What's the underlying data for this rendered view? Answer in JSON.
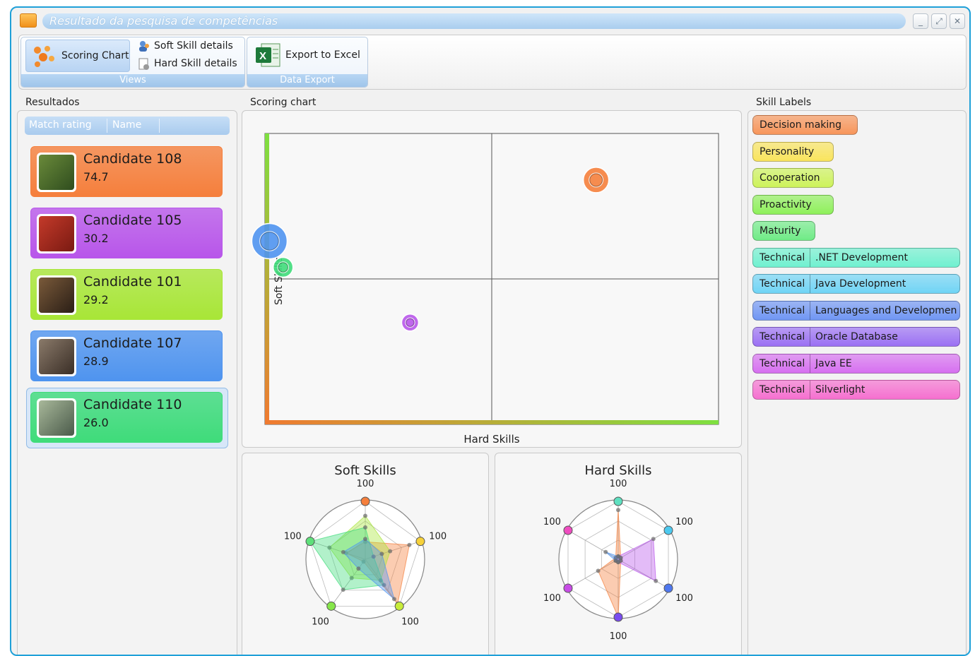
{
  "window": {
    "title": "Resultado da pesquisa de competências",
    "buttons": [
      "_",
      "⤢",
      "✕"
    ]
  },
  "ribbon": {
    "views_group": {
      "label": "Views",
      "scoring_chart": "Scoring Chart",
      "soft_skill_details": "Soft Skill details",
      "hard_skill_details": "Hard Skill details"
    },
    "export_group": {
      "label": "Data Export",
      "export_excel": "Export to Excel"
    }
  },
  "results": {
    "title": "Resultados",
    "columns": [
      "Match rating",
      "Name"
    ],
    "candidates": [
      {
        "name": "Candidate 108",
        "score": "74.7",
        "color": "#f57f3c"
      },
      {
        "name": "Candidate 105",
        "score": "30.2",
        "color": "#b856ea"
      },
      {
        "name": "Candidate 101",
        "score": "29.2",
        "color": "#a8e637"
      },
      {
        "name": "Candidate 107",
        "score": "28.9",
        "color": "#4f94ef"
      },
      {
        "name": "Candidate 110",
        "score": "26.0",
        "color": "#3fdc7a"
      }
    ]
  },
  "scoring": {
    "title": "Scoring chart",
    "xlabel": "Hard Skills",
    "ylabel": "Soft Skills"
  },
  "chart_data": [
    {
      "type": "scatter",
      "title": "Scoring chart",
      "xlabel": "Hard Skills",
      "ylabel": "Soft Skills",
      "xlim": [
        0,
        100
      ],
      "ylim": [
        0,
        100
      ],
      "series": [
        {
          "name": "Candidate 108",
          "x": 73,
          "y": 84,
          "color": "#f57f3c"
        },
        {
          "name": "Candidate 107",
          "x": 1,
          "y": 63,
          "color": "#4f94ef"
        },
        {
          "name": "Candidate 110",
          "x": 4,
          "y": 54,
          "color": "#3fdc7a"
        },
        {
          "name": "Candidate 105",
          "x": 32,
          "y": 35,
          "color": "#b856ea"
        }
      ]
    },
    {
      "type": "radar",
      "title": "Soft Skills",
      "axes_labels": [
        "100",
        "100",
        "100",
        "100",
        "100"
      ],
      "axis_colors": [
        "#f57f3c",
        "#f6d13a",
        "#c8ec3a",
        "#86e64a",
        "#5ee07a"
      ],
      "series": [
        {
          "color": "#f57f3c",
          "values": [
            30,
            80,
            95,
            5,
            35
          ]
        },
        {
          "color": "#a8e637",
          "values": [
            75,
            45,
            45,
            40,
            65
          ]
        },
        {
          "color": "#3fdc7a",
          "values": [
            55,
            15,
            55,
            65,
            100
          ]
        },
        {
          "color": "#4f94ef",
          "values": [
            35,
            30,
            85,
            20,
            40
          ]
        }
      ]
    },
    {
      "type": "radar",
      "title": "Hard Skills",
      "axes_labels": [
        "100",
        "100",
        "100",
        "100",
        "100",
        "100"
      ],
      "axis_colors": [
        "#5ee0c0",
        "#4cc9ef",
        "#4f78ef",
        "#7a4cef",
        "#c84ce6",
        "#ef4cc0"
      ],
      "series": [
        {
          "color": "#f57f3c",
          "values": [
            85,
            5,
            5,
            100,
            40,
            5
          ]
        },
        {
          "color": "#b856ea",
          "values": [
            5,
            70,
            75,
            5,
            5,
            5
          ]
        },
        {
          "color": "#4f94ef",
          "values": [
            5,
            5,
            5,
            5,
            5,
            25
          ]
        }
      ]
    }
  ],
  "skills": {
    "title": "Skill Labels",
    "items": [
      {
        "main": "Decision making",
        "sub": "",
        "color": "#f7955a"
      },
      {
        "main": "Personality",
        "sub": "",
        "color": "#f9e45c"
      },
      {
        "main": "Cooperation",
        "sub": "",
        "color": "#cdf25a"
      },
      {
        "main": "Proactivity",
        "sub": "",
        "color": "#8ef05a"
      },
      {
        "main": "Maturity",
        "sub": "",
        "color": "#6feb86"
      },
      {
        "main": "Technical",
        "sub": ".NET Development",
        "color": "#6ff0cf"
      },
      {
        "main": "Technical",
        "sub": "Java Development",
        "color": "#6fd4f5"
      },
      {
        "main": "Technical",
        "sub": "Languages and Developmen",
        "color": "#6f95f3"
      },
      {
        "main": "Technical",
        "sub": "Oracle Database",
        "color": "#9a6ff3"
      },
      {
        "main": "Technical",
        "sub": "Java EE",
        "color": "#d66ff0"
      },
      {
        "main": "Technical",
        "sub": "Silverlight",
        "color": "#f56fcf"
      }
    ]
  }
}
